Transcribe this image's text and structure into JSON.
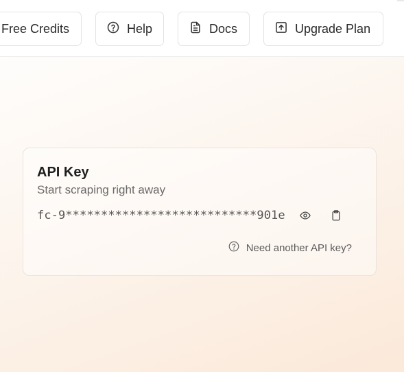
{
  "header": {
    "buttons": [
      {
        "label": "Free Credits",
        "icon": "gift-icon"
      },
      {
        "label": "Help",
        "icon": "help-circle-icon"
      },
      {
        "label": "Docs",
        "icon": "document-icon"
      },
      {
        "label": "Upgrade Plan",
        "icon": "upload-box-icon"
      }
    ]
  },
  "api_key_card": {
    "title": "API Key",
    "subtitle": "Start scraping right away",
    "masked_key": "fc-9***************************901e",
    "show_icon": "eye-icon",
    "copy_icon": "clipboard-icon",
    "another_key_label": "Need another API key?",
    "another_key_icon": "help-circle-icon"
  }
}
